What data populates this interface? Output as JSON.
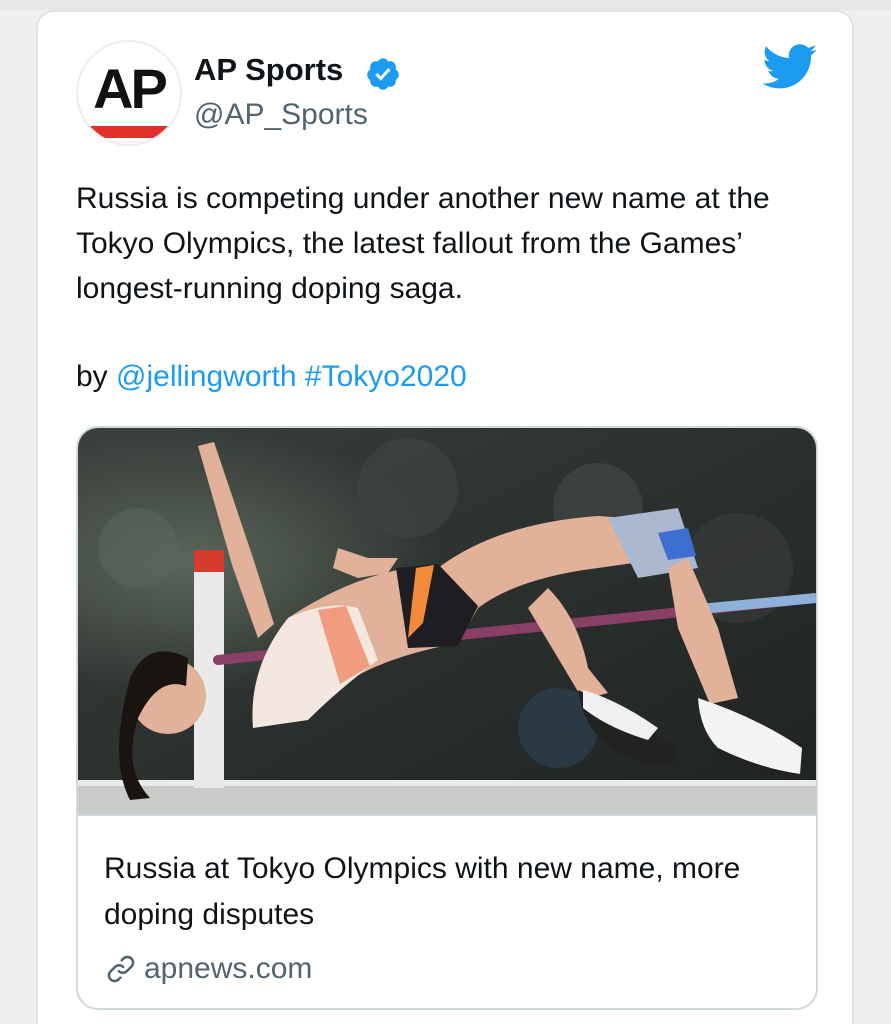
{
  "tweet": {
    "author": {
      "avatar_text": "AP",
      "name": "AP Sports",
      "handle": "@AP_Sports",
      "verified": true
    },
    "brand_icon": "twitter-bird-icon",
    "text": "Russia is competing under another new name at the Tokyo Olympics, the latest fallout from the Games’ longest-running doping saga.",
    "byline": {
      "prefix": "by ",
      "mention": "@jellingworth",
      "hashtag": "#Tokyo2020"
    },
    "link_card": {
      "title": "Russia at Tokyo Olympics with new name, more doping disputes",
      "domain": "apnews.com",
      "image_alt": "high-jumper-clearing-bar-photo",
      "icon": "link-icon"
    }
  },
  "colors": {
    "accent_blue": "#1d9bf0",
    "ap_red": "#e0302a",
    "text_primary": "#0f1419",
    "text_secondary": "#536471",
    "border": "#cfd9de"
  }
}
